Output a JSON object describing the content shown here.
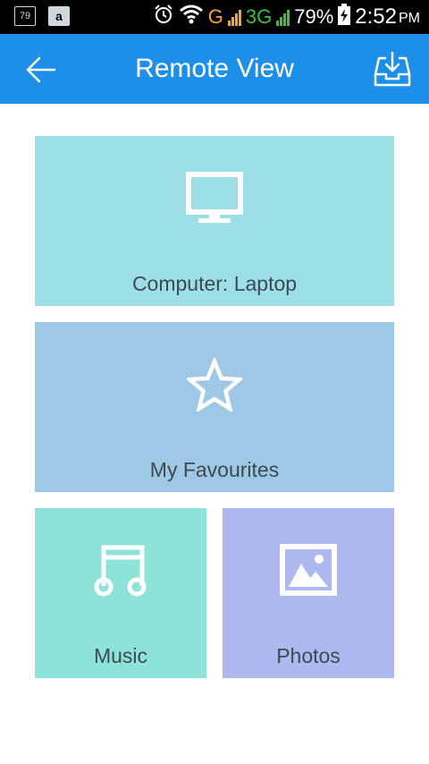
{
  "status_bar": {
    "notification_1": "79",
    "notification_2": "a",
    "network_g": "G",
    "network_3g": "3G",
    "battery": "79%",
    "time": "2:52",
    "am_pm": "PM",
    "icons": [
      "alarm-icon",
      "wifi-icon",
      "signal-icon",
      "battery-icon"
    ]
  },
  "app_bar": {
    "title": "Remote View",
    "back_icon": "arrow-left-icon",
    "action_icon": "download-tray-icon",
    "color": "#1e8fe8"
  },
  "tiles": [
    {
      "label": "Computer: Laptop",
      "icon": "monitor-icon",
      "color": "#9ddfe7"
    },
    {
      "label": "My Favourites",
      "icon": "star-icon",
      "color": "#9fc8e6"
    },
    {
      "label": "Music",
      "icon": "music-note-icon",
      "color": "#8ee3d9"
    },
    {
      "label": "Photos",
      "icon": "image-icon",
      "color": "#adb8ee"
    }
  ]
}
